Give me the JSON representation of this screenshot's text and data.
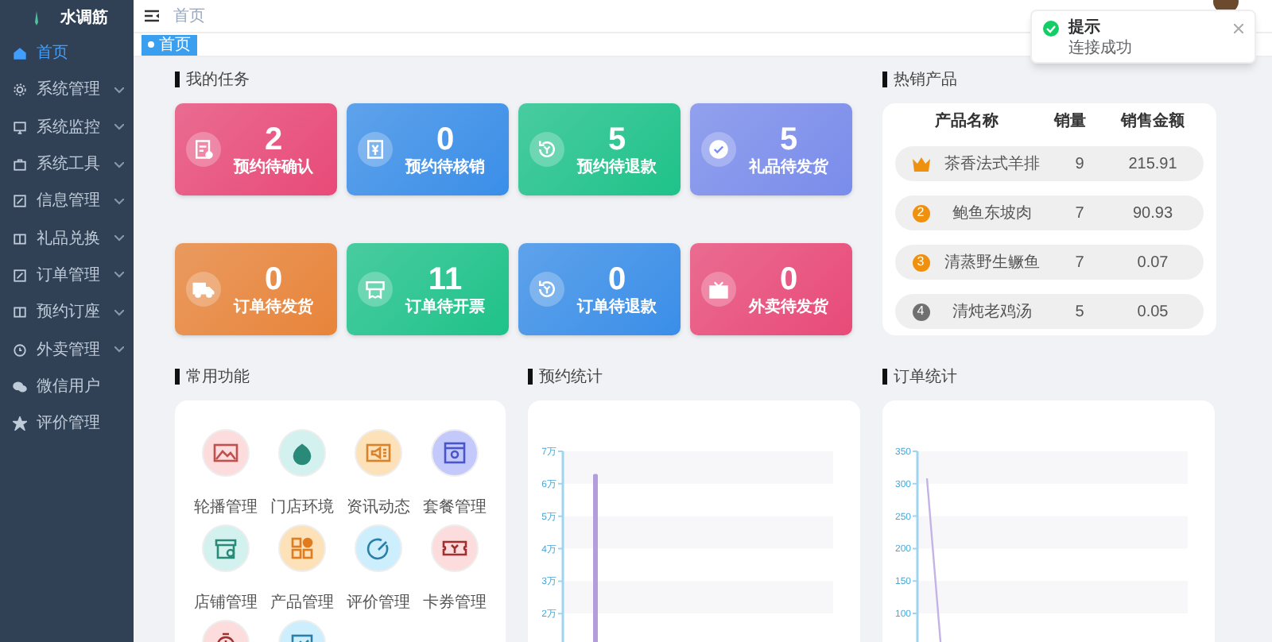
{
  "sidebar": {
    "logo": "水调筋",
    "items": [
      {
        "label": "首页",
        "selected": true,
        "expandable": false
      },
      {
        "label": "系统管理",
        "selected": false,
        "expandable": true
      },
      {
        "label": "系统监控",
        "selected": false,
        "expandable": true
      },
      {
        "label": "系统工具",
        "selected": false,
        "expandable": true
      },
      {
        "label": "信息管理",
        "selected": false,
        "expandable": true
      },
      {
        "label": "礼品兑换",
        "selected": false,
        "expandable": true
      },
      {
        "label": "订单管理",
        "selected": false,
        "expandable": true
      },
      {
        "label": "预约订座",
        "selected": false,
        "expandable": true
      },
      {
        "label": "外卖管理",
        "selected": false,
        "expandable": true
      },
      {
        "label": "微信用户",
        "selected": false,
        "expandable": false
      },
      {
        "label": "评价管理",
        "selected": false,
        "expandable": false
      }
    ]
  },
  "header": {
    "breadcrumb": "首页"
  },
  "tags": [
    {
      "label": "首页",
      "selected": true
    }
  ],
  "toast": {
    "title": "提示",
    "message": "连接成功"
  },
  "tasks": {
    "title": "我的任务",
    "cards": [
      {
        "value": "2",
        "label": "预约待确认",
        "color": "#e84a78"
      },
      {
        "value": "0",
        "label": "预约待核销",
        "color": "#3a8ee8"
      },
      {
        "value": "5",
        "label": "预约待退款",
        "color": "#1fc28a"
      },
      {
        "value": "5",
        "label": "礼品待发货",
        "color": "#7a8ceb"
      },
      {
        "value": "0",
        "label": "订单待发货",
        "color": "#e8843a"
      },
      {
        "value": "11",
        "label": "订单待开票",
        "color": "#1fc28a"
      },
      {
        "value": "0",
        "label": "订单待退款",
        "color": "#3a8ee8"
      },
      {
        "value": "0",
        "label": "外卖待发货",
        "color": "#e84a78"
      }
    ]
  },
  "hot_products": {
    "title": "热销产品",
    "columns": [
      "产品名称",
      "销量",
      "销售金额"
    ],
    "rows": [
      {
        "kind": "crown",
        "color": "#f0900f",
        "name": "茶香法式羊排",
        "sales": "9",
        "amount": "215.91"
      },
      {
        "kind": "number",
        "rank": "2",
        "color": "#f0900f",
        "name": "鲍鱼东坡肉",
        "sales": "7",
        "amount": "90.93"
      },
      {
        "kind": "number",
        "rank": "3",
        "color": "#f0900f",
        "name": "清蒸野生鳜鱼",
        "sales": "7",
        "amount": "0.07"
      },
      {
        "kind": "number",
        "rank": "4",
        "color": "#707070",
        "name": "清炖老鸡汤",
        "sales": "5",
        "amount": "0.05"
      }
    ]
  },
  "common": {
    "title": "常用功能",
    "items": [
      {
        "label": "轮播管理",
        "color": "#fcdcdc"
      },
      {
        "label": "门店环境",
        "color": "#d3f1ee"
      },
      {
        "label": "资讯动态",
        "color": "#fde1b8"
      },
      {
        "label": "套餐管理",
        "color": "#c3c9fb"
      },
      {
        "label": "店铺管理",
        "color": "#d3f1ee"
      },
      {
        "label": "产品管理",
        "color": "#fde1b8"
      },
      {
        "label": "评价管理",
        "color": "#cdeefc"
      },
      {
        "label": "卡券管理",
        "color": "#fcdcdc"
      },
      {
        "color": "#fcdcdc"
      },
      {
        "color": "#cdeefc"
      }
    ]
  },
  "booking_stats": {
    "title": "预约统计",
    "chart_data": {
      "type": "bar",
      "categories": [
        null
      ],
      "series": [
        {
          "color": "#b39ddb",
          "values": [
            6.3
          ]
        }
      ],
      "ylim": [
        0,
        7
      ],
      "yticks": [
        {
          "value": 7,
          "label": "7万"
        },
        {
          "value": 6,
          "label": "6万"
        },
        {
          "value": 5,
          "label": "5万"
        },
        {
          "value": 4,
          "label": "4万"
        },
        {
          "value": 3,
          "label": "3万"
        },
        {
          "value": 2,
          "label": "2万"
        }
      ]
    }
  },
  "order_stats": {
    "title": "订单统计",
    "y_axis_labels": [
      "350",
      "300",
      "250",
      "200",
      "150",
      "100"
    ]
  }
}
